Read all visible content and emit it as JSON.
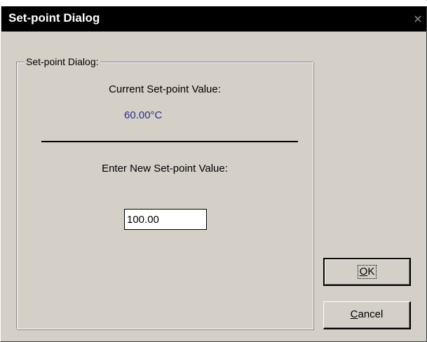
{
  "window": {
    "title": "Set-point Dialog",
    "close_glyph": "×"
  },
  "group": {
    "legend": "Set-point Dialog:",
    "current_label": "Current Set-point Value:",
    "current_value": "60.00°C",
    "current_value_color": "#2b2b8c",
    "enter_label": "Enter New Set-point Value:",
    "input_value": "100.00"
  },
  "buttons": {
    "ok": {
      "mnemonic": "O",
      "rest": "K"
    },
    "cancel": {
      "mnemonic": "C",
      "rest": "ancel"
    }
  },
  "icons": {
    "close": "close-icon"
  }
}
